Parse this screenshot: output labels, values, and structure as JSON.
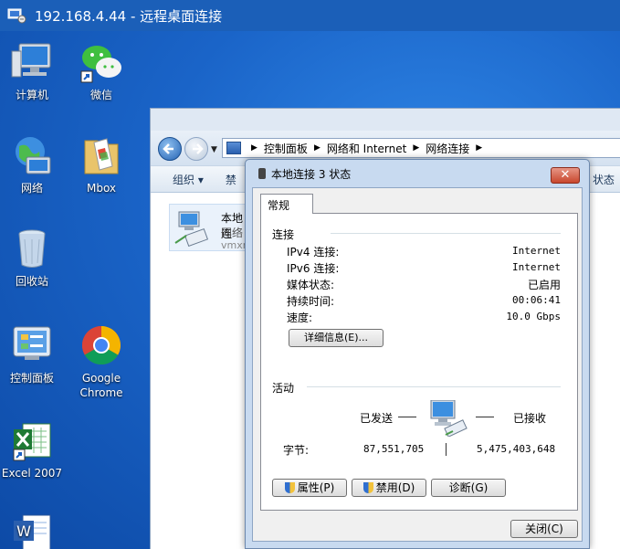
{
  "rdp": {
    "title": "192.168.4.44 - 远程桌面连接"
  },
  "desktop_icons": [
    {
      "label": "计算机",
      "icon": "computer-icon"
    },
    {
      "label": "微信",
      "icon": "wechat-icon"
    },
    {
      "label": "网络",
      "icon": "network-globe-icon"
    },
    {
      "label": "Mbox",
      "icon": "mbox-folder-icon"
    },
    {
      "label": "回收站",
      "icon": "recycle-bin-icon"
    },
    {
      "label": "控制面板",
      "icon": "control-panel-icon"
    },
    {
      "label": "Google Chrome",
      "icon": "chrome-icon"
    },
    {
      "label": "Excel 2007",
      "icon": "excel-icon"
    },
    {
      "label": "",
      "icon": "word-icon"
    }
  ],
  "explorer": {
    "breadcrumb": [
      "控制面板",
      "网络和 Internet",
      "网络连接"
    ],
    "toolbar": {
      "organize": "组织 ▾",
      "disable": "禁",
      "status": "状态"
    },
    "item": {
      "name": "本地连",
      "type": "网络",
      "device": "vmxn"
    }
  },
  "dialog": {
    "title": "本地连接 3 状态",
    "close": "✕",
    "tab": "常规",
    "connection": {
      "header": "连接",
      "rows": [
        {
          "label": "IPv4 连接:",
          "value": "Internet"
        },
        {
          "label": "IPv6 连接:",
          "value": "Internet"
        },
        {
          "label": "媒体状态:",
          "value": "已启用"
        },
        {
          "label": "持续时间:",
          "value": "00:06:41"
        },
        {
          "label": "速度:",
          "value": "10.0 Gbps"
        }
      ],
      "details_button": "详细信息(E)..."
    },
    "activity": {
      "header": "活动",
      "sent_label": "已发送",
      "received_label": "已接收",
      "bytes_label": "字节:",
      "bytes_sent": "87,551,705",
      "bytes_received": "5,475,403,648"
    },
    "buttons": {
      "properties": "属性(P)",
      "disable": "禁用(D)",
      "diagnose": "诊断(G)"
    },
    "close_button": "关闭(C)"
  }
}
